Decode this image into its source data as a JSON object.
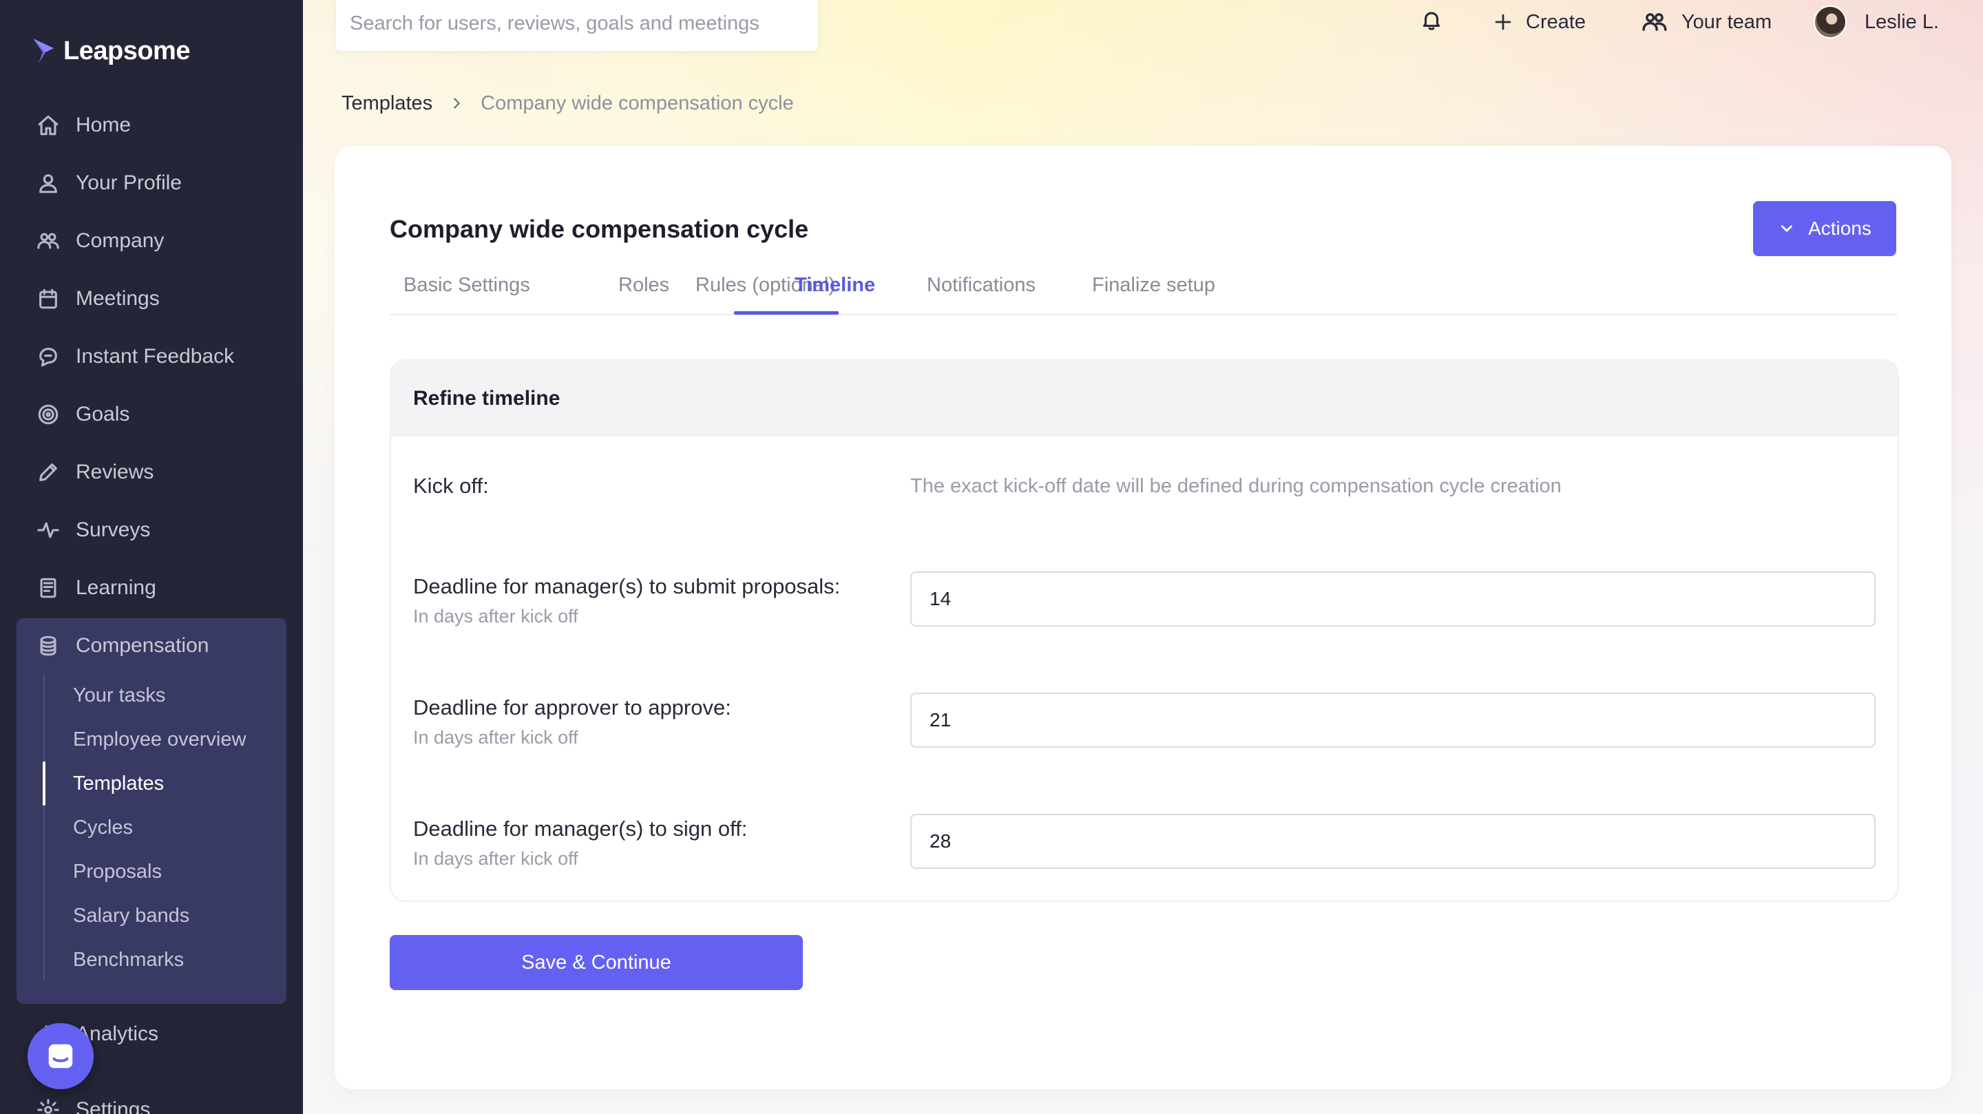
{
  "brand": {
    "name": "Leapsome",
    "accent": "#6461f2",
    "sidebar_bg": "#252538"
  },
  "sidebar": {
    "items": [
      {
        "label": "Home",
        "icon": "home-icon"
      },
      {
        "label": "Your Profile",
        "icon": "user-icon"
      },
      {
        "label": "Company",
        "icon": "people-icon"
      },
      {
        "label": "Meetings",
        "icon": "calendar-icon"
      },
      {
        "label": "Instant Feedback",
        "icon": "chat-bubble-icon"
      },
      {
        "label": "Goals",
        "icon": "target-icon"
      },
      {
        "label": "Reviews",
        "icon": "pencil-icon"
      },
      {
        "label": "Surveys",
        "icon": "pulse-icon"
      },
      {
        "label": "Learning",
        "icon": "book-icon"
      },
      {
        "label": "Compensation",
        "icon": "coins-icon"
      }
    ],
    "compensation_sub": [
      {
        "label": "Your tasks"
      },
      {
        "label": "Employee overview"
      },
      {
        "label": "Templates",
        "active": true
      },
      {
        "label": "Cycles"
      },
      {
        "label": "Proposals"
      },
      {
        "label": "Salary bands"
      },
      {
        "label": "Benchmarks"
      }
    ],
    "after": [
      {
        "label": "Analytics",
        "icon": "chart-icon"
      },
      {
        "label": "Settings",
        "icon": "gear-icon"
      }
    ]
  },
  "topbar": {
    "search_placeholder": "Search for users, reviews, goals and meetings",
    "create_label": "Create",
    "team_label": "Your team",
    "user_name": "Leslie L."
  },
  "breadcrumb": {
    "root": "Templates",
    "current": "Company wide compensation cycle"
  },
  "page": {
    "title": "Company wide compensation cycle",
    "actions_label": "Actions",
    "tabs": [
      {
        "label": "Basic Settings"
      },
      {
        "label": "Roles"
      },
      {
        "label": "Rules (optional)"
      },
      {
        "label": "Timeline",
        "active": true
      },
      {
        "label": "Notifications"
      },
      {
        "label": "Finalize setup"
      }
    ]
  },
  "timeline": {
    "section_title": "Refine timeline",
    "kickoff_label": "Kick off:",
    "kickoff_note": "The exact kick-off date will be defined during compensation cycle creation",
    "fields": [
      {
        "label": "Deadline for manager(s) to submit proposals:",
        "sublabel": "In days after kick off",
        "value": "14"
      },
      {
        "label": "Deadline for approver to approve:",
        "sublabel": "In days after kick off",
        "value": "21"
      },
      {
        "label": "Deadline for manager(s) to sign off:",
        "sublabel": "In days after kick off",
        "value": "28"
      }
    ],
    "save_label": "Save & Continue"
  }
}
